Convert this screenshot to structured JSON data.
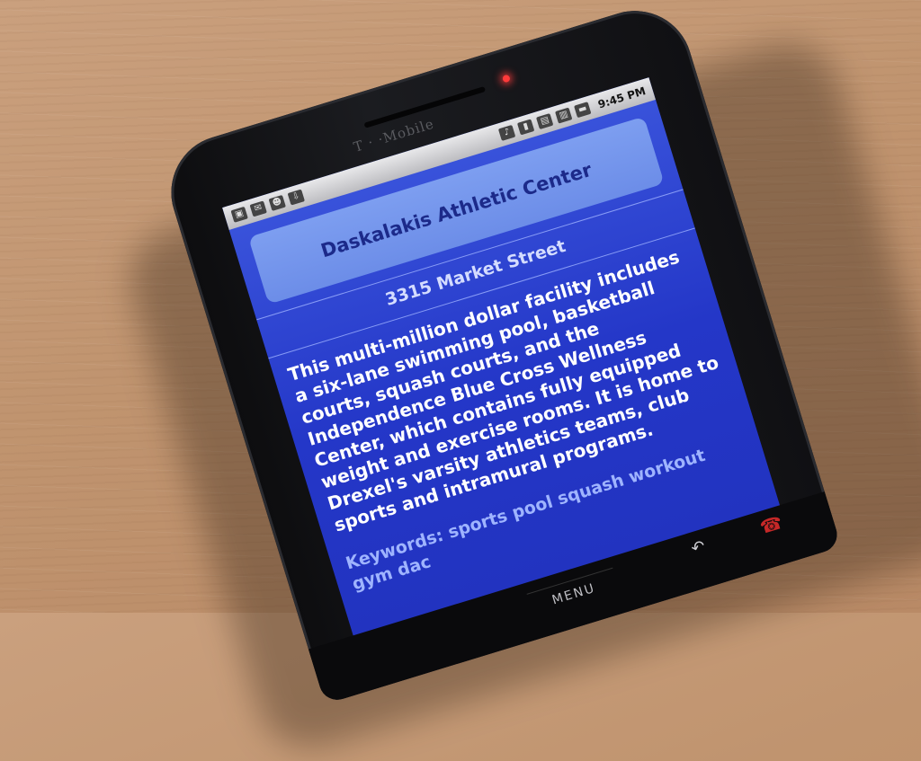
{
  "device": {
    "brand": "T · ·Mobile",
    "status_time": "9:45 PM",
    "menu_key": "MENU"
  },
  "app": {
    "title": "Daskalakis Athletic Center",
    "address": "3315 Market Street",
    "description": "This multi-million dollar facility includes a six-lane swimming pool, basketball courts, squash courts, and the Independence Blue Cross Wellness Center, which contains fully equipped weight and exercise rooms. It is home to Drexel's varsity athletics teams, club sports and intramural programs.",
    "keywords": "Keywords: sports pool squash workout gym dac"
  },
  "colors": {
    "screen": "#2437c8",
    "title_box": "#6c8de8",
    "led": "#ff3a3a",
    "table": "#c0946f"
  }
}
